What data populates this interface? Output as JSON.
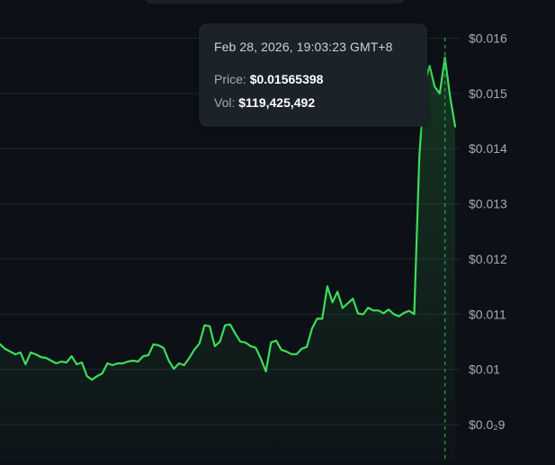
{
  "tooltip": {
    "date": "Feb 28, 2026, 19:03:23 GMT+8",
    "price_label": "Price:",
    "price_value": "$0.01565398",
    "vol_label": "Vol:",
    "vol_value": "$119,425,492"
  },
  "colors": {
    "background": "#0d1117",
    "line": "#3ddc5a",
    "grid": "#22272e",
    "crosshair": "#2ea043",
    "tick_text": "#a2acb7"
  },
  "chart_data": {
    "type": "area",
    "title": "",
    "xlabel": "",
    "ylabel": "",
    "ylim": [
      0.0089,
      0.0163
    ],
    "y_ticks": [
      "$0.016",
      "$0.015",
      "$0.014",
      "$0.013",
      "$0.012",
      "$0.011",
      "$0.01",
      "$0.0₂9"
    ],
    "y_tick_values": [
      0.016,
      0.015,
      0.014,
      0.013,
      0.012,
      0.011,
      0.01,
      0.009
    ],
    "grid": true,
    "crosshair_value": 0.01565398,
    "series": [
      {
        "values": [
          0.010456,
          0.010371,
          0.010321,
          0.010272,
          0.010305,
          0.010091,
          0.010305,
          0.010272,
          0.010223,
          0.010206,
          0.010157,
          0.010108,
          0.010141,
          0.010124,
          0.010239,
          0.010091,
          0.010124,
          0.009877,
          0.009812,
          0.009877,
          0.009927,
          0.010108,
          0.010075,
          0.010108,
          0.010108,
          0.010141,
          0.010157,
          0.010141,
          0.010239,
          0.010255,
          0.010453,
          0.010436,
          0.010387,
          0.010157,
          0.010009,
          0.010108,
          0.010075,
          0.010206,
          0.010354,
          0.010469,
          0.010799,
          0.010782,
          0.01042,
          0.010502,
          0.010798,
          0.010814,
          0.010649,
          0.010503,
          0.010486,
          0.010421,
          0.010391,
          0.010193,
          0.009961,
          0.010486,
          0.010521,
          0.010356,
          0.010323,
          0.010274,
          0.010274,
          0.010372,
          0.010406,
          0.010735,
          0.010917,
          0.010917,
          0.011505,
          0.011213,
          0.011405,
          0.011113,
          0.011197,
          0.01128,
          0.011013,
          0.010996,
          0.011117,
          0.011067,
          0.011067,
          0.011016,
          0.011083,
          0.011,
          0.01096,
          0.011025,
          0.01106,
          0.011,
          0.01386,
          0.01518,
          0.0155,
          0.01512,
          0.015,
          0.01565,
          0.01495,
          0.0144
        ]
      }
    ]
  }
}
